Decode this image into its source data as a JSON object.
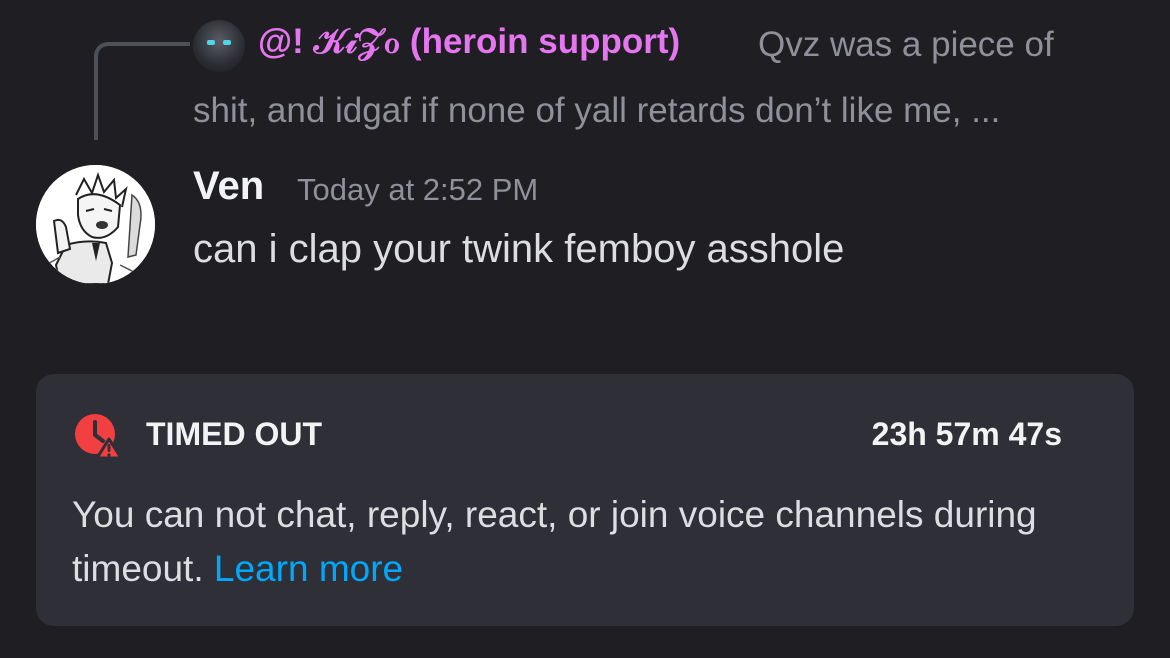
{
  "reply": {
    "author": "@! 𝒦𝒾𝒵ℴ (heroin support)",
    "text_line1": "Qvz was a piece of",
    "text_line2": "shit, and idgaf if none of yall retards don’t like me, ..."
  },
  "message": {
    "author": "Ven",
    "timestamp": "Today at 2:52 PM",
    "content": "can i clap your twink femboy asshole"
  },
  "timeout": {
    "title": "TIMED OUT",
    "remaining": "23h 57m 47s",
    "body": "You can not chat, reply, react, or join voice channels during timeout.",
    "link_label": "Learn more",
    "icon": "clock-alert-icon"
  },
  "colors": {
    "background": "#1f1f23",
    "card": "#2f2f37",
    "reply_author": "#e675f0",
    "link": "#00a8fc",
    "alert": "#f23f42"
  }
}
